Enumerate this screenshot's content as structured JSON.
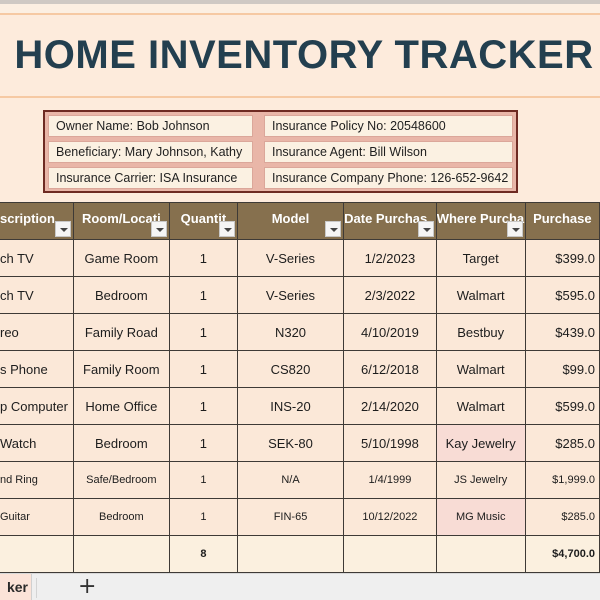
{
  "title": "HOME INVENTORY TRACKER",
  "info": {
    "owner": "Owner Name: Bob Johnson",
    "beneficiary": "Beneficiary: Mary Johnson, Kathy",
    "carrier": "Insurance Carrier: ISA Insurance",
    "policy": "Insurance Policy No:  20548600",
    "agent": "Insurance Agent: Bill Wilson",
    "phone": "Insurance Company Phone: 126-652-9642"
  },
  "table": {
    "headers": [
      "scription",
      "Room/Locati",
      "Quantit",
      "Model",
      "Date Purchas",
      "Where Purcha",
      "Purchase"
    ],
    "rows": [
      {
        "description": "ch TV",
        "room": "Game Room",
        "quantity": "1",
        "model": "V-Series",
        "date": "1/2/2023",
        "where": "Target",
        "price": "$399.0"
      },
      {
        "description": "ch TV",
        "room": "Bedroom",
        "quantity": "1",
        "model": "V-Series",
        "date": "2/3/2022",
        "where": "Walmart",
        "price": "$595.0"
      },
      {
        "description": "reo",
        "room": "Family Road",
        "quantity": "1",
        "model": "N320",
        "date": "4/10/2019",
        "where": "Bestbuy",
        "price": "$439.0"
      },
      {
        "description": "s Phone",
        "room": "Family Room",
        "quantity": "1",
        "model": "CS820",
        "date": "6/12/2018",
        "where": "Walmart",
        "price": "$99.0"
      },
      {
        "description": "p Computer",
        "room": "Home Office",
        "quantity": "1",
        "model": "INS-20",
        "date": "2/14/2020",
        "where": "Walmart",
        "price": "$599.0"
      },
      {
        "description": " Watch",
        "room": "Bedroom",
        "quantity": "1",
        "model": "SEK-80",
        "date": "5/10/1998",
        "where": "Kay Jewelry",
        "price": "$285.0"
      },
      {
        "description": "nd Ring",
        "room": "Safe/Bedroom",
        "quantity": "1",
        "model": "N/A",
        "date": "1/4/1999",
        "where": "JS Jewelry",
        "price": "$1,999.0"
      },
      {
        "description": "Guitar",
        "room": "Bedroom",
        "quantity": "1",
        "model": "FIN-65",
        "date": "10/12/2022",
        "where": "MG Music",
        "price": "$285.0"
      }
    ],
    "total": {
      "quantity": "8",
      "price": "$4,700.0"
    }
  },
  "tabs": {
    "active": "ker",
    "add": "+"
  }
}
